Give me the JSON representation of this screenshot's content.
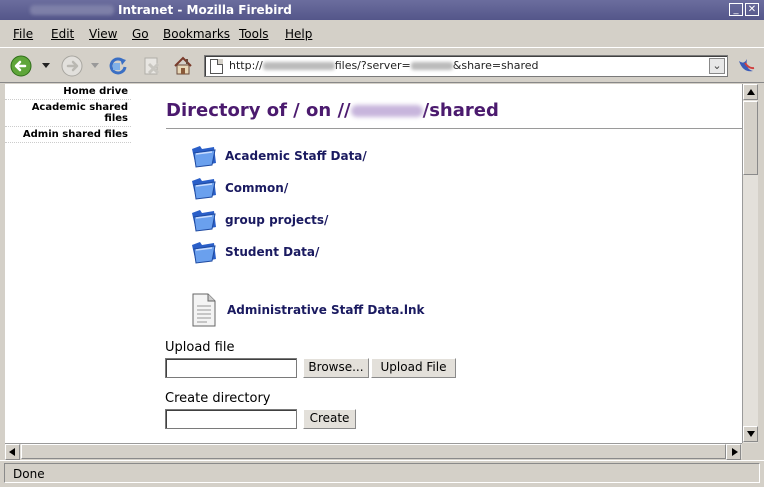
{
  "window": {
    "title": "Intranet - Mozilla Firebird",
    "minimize_glyph": "_",
    "close_glyph": "✕"
  },
  "menu": {
    "items": [
      {
        "label": "File",
        "accesskey_index": 0
      },
      {
        "label": "Edit",
        "accesskey_index": 0
      },
      {
        "label": "View",
        "accesskey_index": 0
      },
      {
        "label": "Go",
        "accesskey_index": 0
      },
      {
        "label": "Bookmarks",
        "accesskey_index": 0
      },
      {
        "label": "Tools",
        "accesskey_index": 0
      },
      {
        "label": "Help",
        "accesskey_index": 0
      }
    ]
  },
  "toolbar": {
    "icons": [
      "back-icon",
      "forward-icon",
      "reload-icon",
      "stop-icon",
      "home-icon"
    ],
    "url_prefix": "http://",
    "url_mid": "files/?server=",
    "url_suffix": "&share=shared",
    "go_glyph": "⌄",
    "throbber_icon": "firebird-throbber-icon"
  },
  "sidebar": {
    "links": [
      "Home drive",
      "Academic shared files",
      "Admin shared files"
    ]
  },
  "main": {
    "heading_prefix": "Directory of / on //",
    "heading_suffix": "/shared",
    "folders": [
      "Academic Staff Data/",
      "Common/",
      "group projects/",
      "Student Data/"
    ],
    "file": "Administrative Staff Data.lnk",
    "upload_label": "Upload file",
    "browse_button": "Browse...",
    "upload_button": "Upload File",
    "create_dir_label": "Create directory",
    "create_button": "Create"
  },
  "status": {
    "text": "Done"
  },
  "colors": {
    "heading": "#4b1a6e",
    "link": "#1a1a60",
    "titlebar": "#5a5c8f"
  }
}
